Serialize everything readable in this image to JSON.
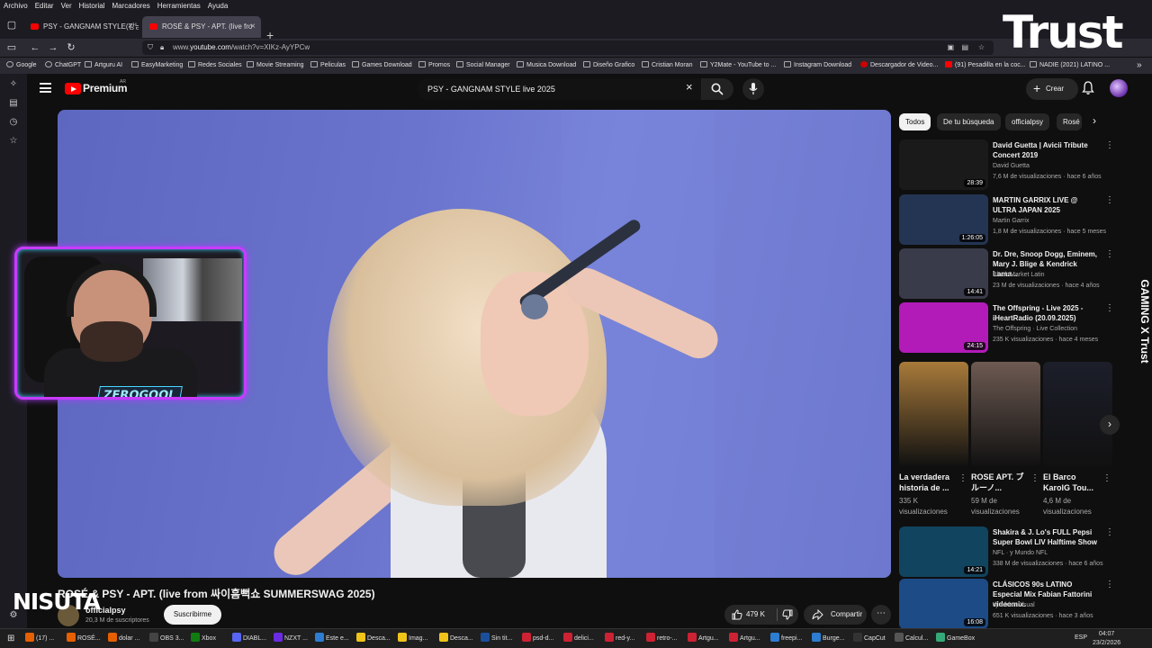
{
  "menubar": [
    "Archivo",
    "Editar",
    "Ver",
    "Historial",
    "Marcadores",
    "Herramientas",
    "Ayuda"
  ],
  "tabs": [
    {
      "title": "PSY - GANGNAM STYLE(강남스",
      "active": false
    },
    {
      "title": "ROSÉ & PSY - APT. (live fro",
      "active": true
    }
  ],
  "url": {
    "prefix": "www.",
    "domain": "youtube.com",
    "path": "/watch?v=XIKz-AyYPCw"
  },
  "bookmarks": [
    "Google",
    "ChatGPT",
    "Artguru AI",
    "EasyMarketing",
    "Redes Sociales",
    "Movie Streaming",
    "Peliculas",
    "Games Download",
    "Promos",
    "Social Manager",
    "Musica Download",
    "Diseño Grafico",
    "Cristian Moran",
    "Y2Mate - YouTube to ...",
    "Instagram Download",
    "Descargador de Video...",
    "(91) Pesadilla en la coc...",
    "NADIE (2021) LATINO ..."
  ],
  "youtube": {
    "brand": "Premium",
    "region": "AR",
    "search_value": "PSY - GANGNAM STYLE live 2025",
    "create_label": "Crear"
  },
  "video": {
    "title": "ROSÉ & PSY - APT. (live from 싸이흠뻑쇼 SUMMERSWAG 2025)",
    "channel": "officialpsy",
    "subscribers": "20,3 M de suscriptores",
    "subscribe_label": "Suscribirme",
    "likes": "479 K",
    "share_label": "Compartir"
  },
  "chips": [
    "Todos",
    "De tu búsqueda",
    "officialpsy",
    "Rosé"
  ],
  "related": [
    {
      "title": "David Guetta | Avicii Tribute Concert 2019",
      "channel": "David Guetta",
      "meta": "7,6 M de visualizaciones · hace 6 años",
      "duration": "28:39",
      "color": "#1a1a1a"
    },
    {
      "title": "MARTIN GARRIX LIVE @ ULTRA JAPAN 2025",
      "channel": "Martin Garrix",
      "meta": "1,8 M de visualizaciones · hace 5 meses",
      "duration": "1:26:05",
      "color": "#243553"
    },
    {
      "title": "Dr. Dre, Snoop Dogg, Eminem, Mary J. Blige & Kendrick Lama...",
      "channel": "Black Market Latin",
      "meta": "23 M de visualizaciones · hace 4 años",
      "duration": "14:41",
      "color": "#3a3b4a"
    },
    {
      "title": "The Offspring - Live 2025 - iHeartRadio (20.09.2025)",
      "channel": "The Offspring · Live Collection",
      "meta": "235 K visualizaciones · hace 4 meses",
      "duration": "24:15",
      "color": "#b21bb8"
    },
    {
      "title": "Shakira & J. Lo's FULL Pepsi Super Bowl LIV Halftime Show",
      "channel": "NFL · y Mundo NFL",
      "meta": "338 M de visualizaciones · hace 6 años",
      "duration": "14:21",
      "color": "#11445e"
    },
    {
      "title": "CLÁSICOS 90s LATINO Especial Mix Fabian Fattorini videomix.",
      "channel": "dj adrian visual",
      "meta": "651 K visualizaciones · hace 3 años",
      "duration": "16:08",
      "color": "#1c4b86"
    }
  ],
  "shorts": [
    {
      "title": "La verdadera historia de ...",
      "meta": "335 K visualizaciones",
      "color": "#a87a3a"
    },
    {
      "title": "ROSE APT. ブルーノ...",
      "meta": "59 M de visualizaciones",
      "color": "#6d5a52"
    },
    {
      "title": "El Barco KarolG Tou...",
      "meta": "4,6 M de visualizaciones",
      "color": "#1c1e2a"
    }
  ],
  "overlays": {
    "webcam_label": "ZEROGOOL",
    "brand_top": "Trust",
    "vertical_brand": "GAMING X Trust",
    "bottom_logo": "NISUTA"
  },
  "taskbar": {
    "items": [
      "(17) ...",
      "ROSÉ...",
      "dolar ...",
      "OBS 3...",
      "Xbox",
      "DIABL...",
      "NZXT ...",
      "Este e...",
      "Desca...",
      "Imag...",
      "Desca...",
      "Sin tit...",
      "psd-d...",
      "delici...",
      "red-y...",
      "retro-...",
      "Artgu...",
      "Artgu...",
      "freepi...",
      "Burge...",
      "CapCut",
      "Calcul...",
      "GameBox"
    ],
    "lang": "ESP",
    "time": "04:07",
    "date": "23/2/2026"
  }
}
